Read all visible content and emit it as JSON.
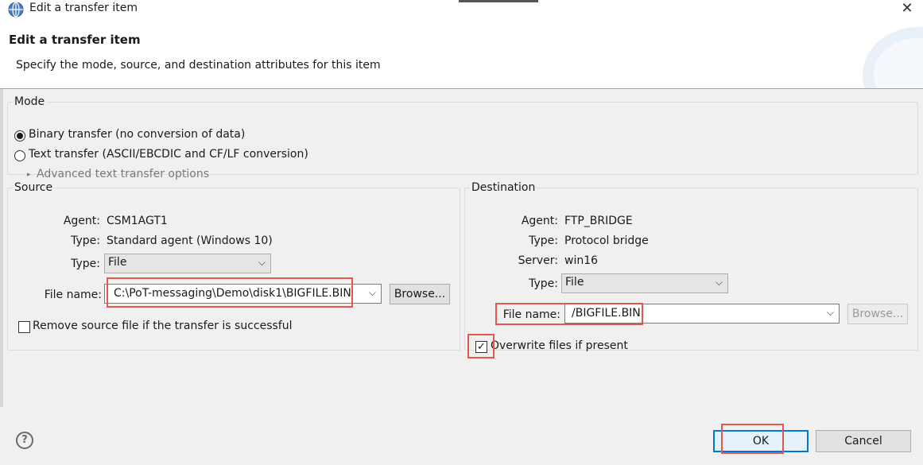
{
  "window": {
    "title": "Edit a transfer item",
    "close_symbol": "✕",
    "icon": "globe-icon"
  },
  "header": {
    "title": "Edit a transfer item",
    "description": "Specify the mode, source, and destination attributes for this item"
  },
  "mode": {
    "legend": "Mode",
    "options": [
      {
        "label": "Binary transfer (no conversion of data)",
        "checked": true
      },
      {
        "label": "Text transfer (ASCII/EBCDIC and CF/LF conversion)",
        "checked": false
      }
    ],
    "advanced_label": "Advanced text transfer options"
  },
  "source": {
    "legend": "Source",
    "agent_label": "Agent:",
    "agent_value": "CSM1AGT1",
    "type_label": "Type:",
    "type_value": "Standard agent (Windows 10)",
    "type_select_label": "Type:",
    "type_select_value": "File",
    "file_label": "File name:",
    "file_value": "C:\\PoT-messaging\\Demo\\disk1\\BIGFILE.BIN",
    "browse_label": "Browse...",
    "remove_label": "Remove source file if the transfer is successful",
    "remove_checked": false
  },
  "destination": {
    "legend": "Destination",
    "agent_label": "Agent:",
    "agent_value": "FTP_BRIDGE",
    "type_label": "Type:",
    "type_value": "Protocol bridge",
    "server_label": "Server:",
    "server_value": "win16",
    "type_select_label": "Type:",
    "type_select_value": "File",
    "file_label": "File name:",
    "file_value": "/BIGFILE.BIN",
    "browse_label": "Browse...",
    "overwrite_label": "Overwrite files if present",
    "overwrite_checked": true
  },
  "footer": {
    "help_symbol": "?",
    "ok_label": "OK",
    "cancel_label": "Cancel"
  },
  "colors": {
    "highlight": "#e8554e",
    "default_button_border": "#0078d7"
  },
  "symbols": {
    "chevron": "⌵",
    "check": "✓",
    "triangle": "▸"
  }
}
